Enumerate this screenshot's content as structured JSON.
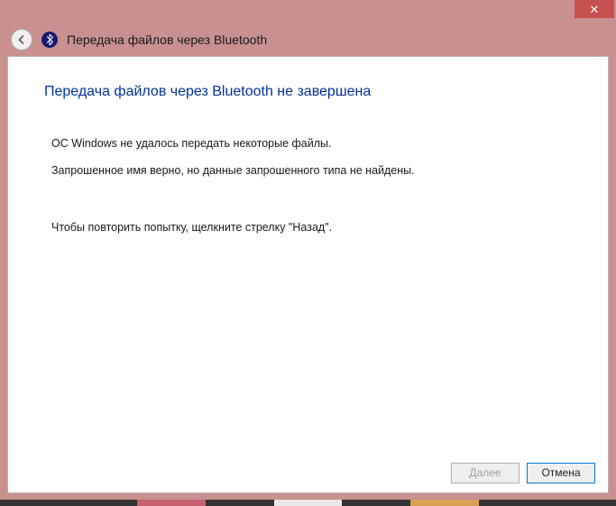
{
  "titlebar": {
    "close": "✕"
  },
  "header": {
    "title": "Передача файлов через Bluetooth"
  },
  "content": {
    "heading": "Передача файлов через Bluetooth не завершена",
    "msg1": "ОС Windows не удалось передать некоторые файлы.",
    "msg2": "Запрошенное имя верно, но данные запрошенного типа не найдены.",
    "retry": "Чтобы повторить попытку, щелкните стрелку \"Назад\"."
  },
  "buttons": {
    "next": "Далее",
    "cancel": "Отмена"
  }
}
